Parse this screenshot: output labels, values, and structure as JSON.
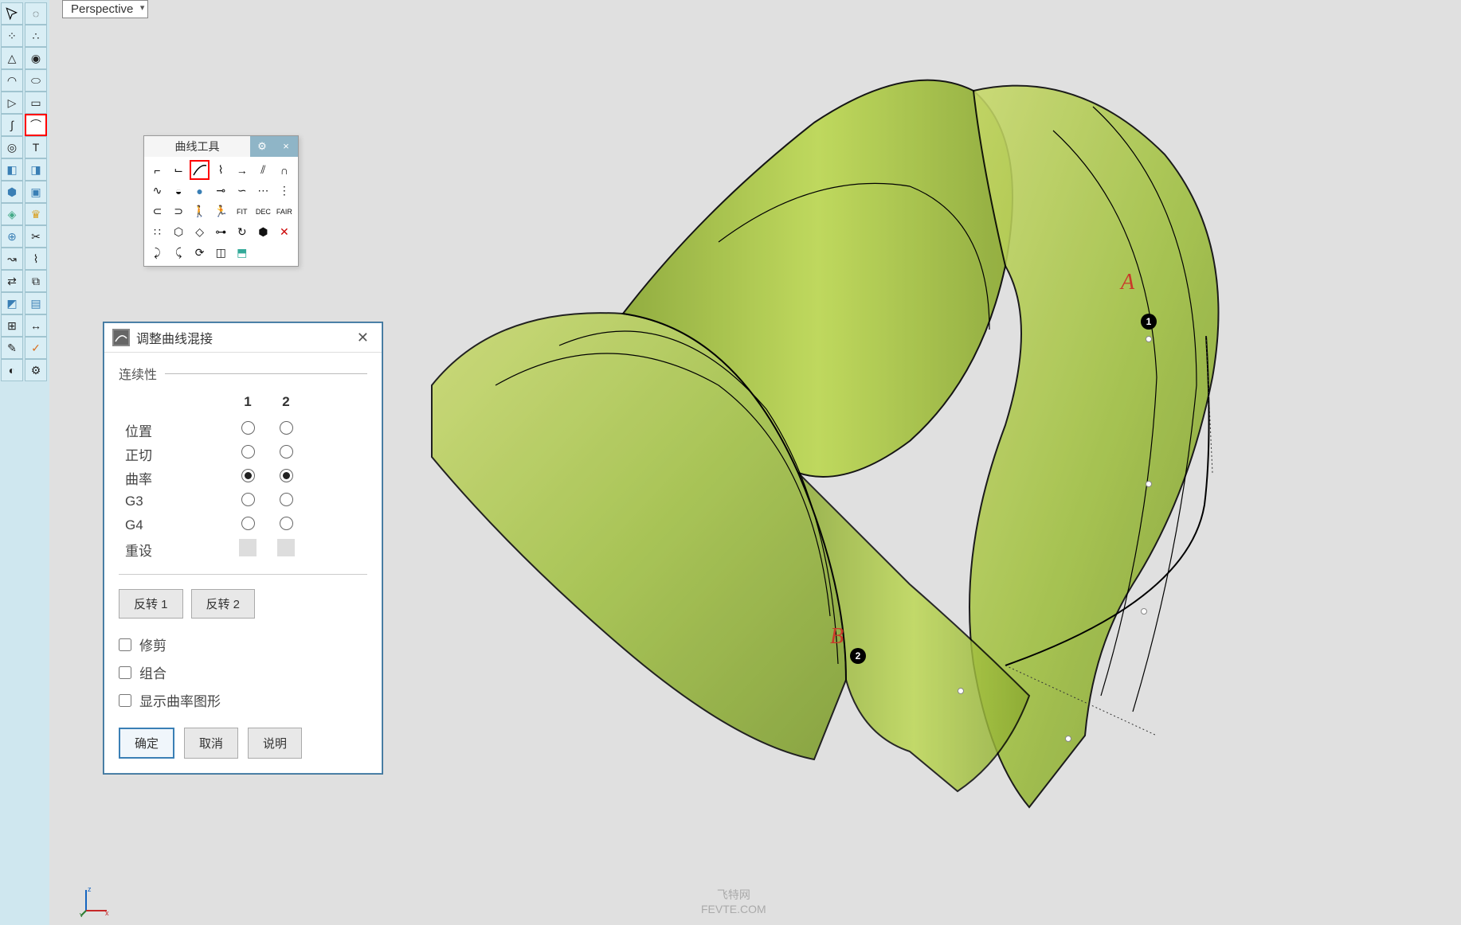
{
  "viewport": {
    "name": "Perspective"
  },
  "toolbox": {
    "title": "曲线工具",
    "highlighted_icon": 2
  },
  "dialog": {
    "title": "调整曲线混接",
    "section": "连续性",
    "col1": "1",
    "col2": "2",
    "rows": {
      "position": {
        "label": "位置",
        "c1": false,
        "c2": false
      },
      "tangent": {
        "label": "正切",
        "c1": false,
        "c2": false
      },
      "curvature": {
        "label": "曲率",
        "c1": true,
        "c2": true
      },
      "g3": {
        "label": "G3",
        "c1": false,
        "c2": false
      },
      "g4": {
        "label": "G4",
        "c1": false,
        "c2": false
      },
      "reset": {
        "label": "重设"
      }
    },
    "flip1": "反转 1",
    "flip2": "反转 2",
    "checks": {
      "trim": {
        "label": "修剪",
        "checked": false
      },
      "join": {
        "label": "组合",
        "checked": false
      },
      "graph": {
        "label": "显示曲率图形",
        "checked": false
      }
    },
    "ok": "确定",
    "cancel": "取消",
    "help": "说明"
  },
  "canvas": {
    "labelA": "A",
    "labelB": "B",
    "marker1": "1",
    "marker2": "2"
  },
  "axis": {
    "z": "z",
    "x": "x",
    "y": "y"
  },
  "watermark": {
    "line1": "飞特网",
    "line2": "FEVTE.COM"
  }
}
